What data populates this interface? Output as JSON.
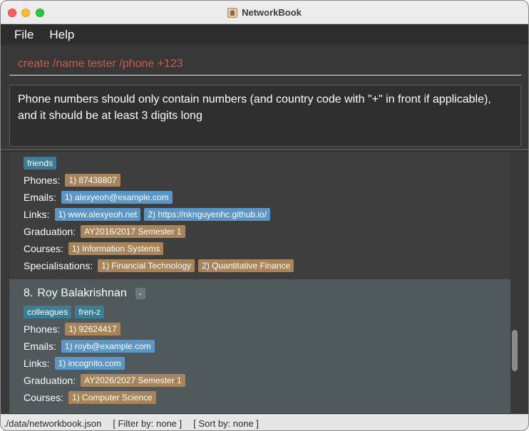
{
  "window": {
    "title": "NetworkBook"
  },
  "menu": {
    "file": "File",
    "help": "Help"
  },
  "command": {
    "value": "create /name tester /phone +123"
  },
  "result": {
    "message": "Phone numbers should only contain numbers (and country code with \"+\" in front if applicable), and it should be at least 3 digits long"
  },
  "contacts": [
    {
      "tags": [
        "friends"
      ],
      "phones_label": "Phones:",
      "phones": [
        "1) 87438807"
      ],
      "emails_label": "Emails:",
      "emails": [
        "1) alexyeoh@example.com"
      ],
      "links_label": "Links:",
      "links": [
        "1) www.alexyeoh.net",
        "2) https://nknguyenhc.github.io/"
      ],
      "graduation_label": "Graduation:",
      "graduation": "AY2016/2017 Semester 1",
      "courses_label": "Courses:",
      "courses": [
        "1) Information Systems"
      ],
      "specialisations_label": "Specialisations:",
      "specialisations": [
        "1) Financial Technology",
        "2) Quantitative Finance"
      ]
    },
    {
      "index": "8.",
      "name": "Roy Balakrishnan",
      "priority": "-",
      "tags": [
        "colleagues",
        "fren-z"
      ],
      "phones_label": "Phones:",
      "phones": [
        "1) 92624417"
      ],
      "emails_label": "Emails:",
      "emails": [
        "1) royb@example.com"
      ],
      "links_label": "Links:",
      "links": [
        "1) incognito.com"
      ],
      "graduation_label": "Graduation:",
      "graduation": "AY2026/2027 Semester 1",
      "courses_label": "Courses:",
      "courses": [
        "1) Computer Science"
      ]
    }
  ],
  "status": {
    "file_path": "./data/networkbook.json",
    "filter": "[ Filter by: none ]",
    "sort": "[ Sort by: none ]"
  },
  "colors": {
    "tag": "#3a7e96",
    "gold_chip": "#a88459",
    "blue_chip": "#5b96c8",
    "command_text": "#d1584c"
  }
}
